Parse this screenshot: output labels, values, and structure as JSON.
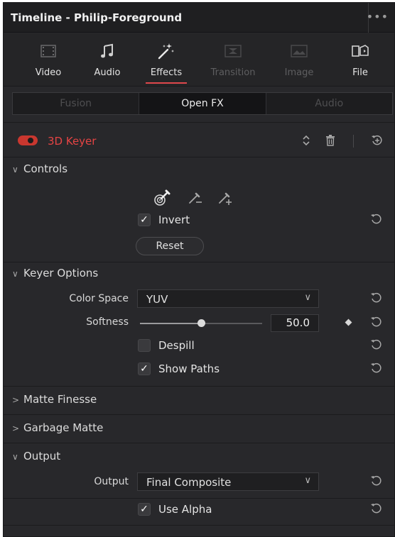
{
  "window": {
    "title": "Timeline - Philip-Foreground"
  },
  "tabs": [
    {
      "label": "Video",
      "icon": "video-icon",
      "state": "normal"
    },
    {
      "label": "Audio",
      "icon": "audio-note-icon",
      "state": "normal"
    },
    {
      "label": "Effects",
      "icon": "magic-wand-icon",
      "state": "active"
    },
    {
      "label": "Transition",
      "icon": "transition-icon",
      "state": "disabled"
    },
    {
      "label": "Image",
      "icon": "image-icon",
      "state": "disabled"
    },
    {
      "label": "File",
      "icon": "file-icon",
      "state": "normal"
    }
  ],
  "subtabs": [
    {
      "label": "Fusion",
      "active": false
    },
    {
      "label": "Open FX",
      "active": true
    },
    {
      "label": "Audio",
      "active": false
    }
  ],
  "effect": {
    "name": "3D Keyer",
    "enabled": true,
    "accent": "#e54444"
  },
  "controls": {
    "header": "Controls",
    "picker_icons": [
      "color-picker-icon",
      "picker-minus-icon",
      "picker-plus-icon"
    ],
    "invert": {
      "label": "Invert",
      "checked": true
    },
    "reset_label": "Reset"
  },
  "keyer_options": {
    "header": "Keyer Options",
    "color_space": {
      "label": "Color Space",
      "value": "YUV"
    },
    "softness": {
      "label": "Softness",
      "value": "50.0",
      "fraction": 0.5
    },
    "despill": {
      "label": "Despill",
      "checked": false
    },
    "show_paths": {
      "label": "Show Paths",
      "checked": true
    }
  },
  "matte_finesse": {
    "header": "Matte Finesse"
  },
  "garbage_matte": {
    "header": "Garbage Matte"
  },
  "output": {
    "header": "Output",
    "output_select": {
      "label": "Output",
      "value": "Final Composite"
    },
    "use_alpha": {
      "label": "Use Alpha",
      "checked": true
    }
  },
  "glyphs": {
    "chevron_down": "∨",
    "chevron_right": ">",
    "checkmark": "✓",
    "menu_dots": "•••"
  }
}
